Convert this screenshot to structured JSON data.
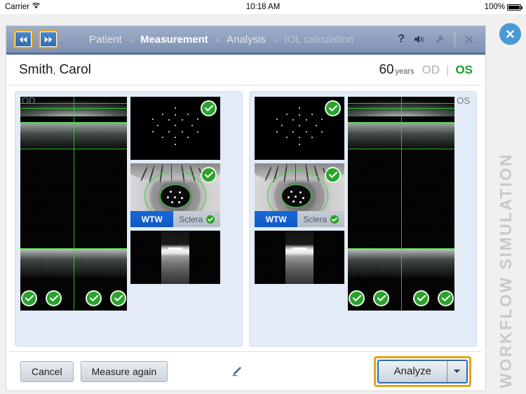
{
  "status_bar": {
    "carrier": "Carrier",
    "wifi_icon": "wifi-icon",
    "time": "10:18 AM",
    "battery_percent": "100%",
    "battery_icon": "battery-full-icon"
  },
  "overlay": {
    "simulation_label": "WORKFLOW SIMULATION",
    "close_icon": "close-circle-icon"
  },
  "navbar": {
    "history_back": {
      "name": "skip-back-icon",
      "label": "Back"
    },
    "history_forward": {
      "name": "skip-forward-icon",
      "label": "Forward"
    },
    "breadcrumbs": [
      {
        "label": "Patient",
        "state": "inactive"
      },
      {
        "label": "Measurement",
        "state": "active"
      },
      {
        "label": "Analysis",
        "state": "inactive"
      },
      {
        "label": "IOL calculation",
        "state": "disabled"
      }
    ],
    "separator": "›",
    "tools": [
      {
        "name": "help-icon",
        "glyph": "?",
        "enabled": true
      },
      {
        "name": "sound-icon",
        "glyph": "speaker",
        "enabled": true
      },
      {
        "name": "wrench-icon",
        "glyph": "wrench",
        "enabled": false
      },
      {
        "name": "close-icon",
        "glyph": "×",
        "enabled": false
      }
    ]
  },
  "patient": {
    "last_name": "Smith",
    "comma": ",",
    "first_name": "Carol",
    "age": "60",
    "age_unit": "years",
    "eye_od": "OD",
    "eye_divider": "|",
    "eye_os": "OS",
    "selected_eye": "OS"
  },
  "measurement": {
    "od": {
      "label": "OD",
      "oct_scan": {
        "name": "oct-bscan-large",
        "checks": 4
      },
      "keratometry": {
        "name": "keratometry-dot-pattern",
        "status": "ok"
      },
      "eye_image": {
        "name": "eye-front-image",
        "status": "ok"
      },
      "toggle": {
        "active": "WTW",
        "inactive": "Sclera",
        "inactive_status": "ok"
      },
      "bscan_thumb": {
        "name": "oct-bscan-thumbnail"
      }
    },
    "os": {
      "label": "OS",
      "oct_scan": {
        "name": "oct-bscan-large",
        "checks": 4
      },
      "keratometry": {
        "name": "keratometry-dot-pattern",
        "status": "ok"
      },
      "eye_image": {
        "name": "eye-front-image",
        "status": "ok"
      },
      "toggle": {
        "active": "WTW",
        "inactive": "Sclera",
        "inactive_status": "ok"
      },
      "bscan_thumb": {
        "name": "oct-bscan-thumbnail"
      }
    }
  },
  "footer": {
    "cancel": "Cancel",
    "measure_again": "Measure again",
    "edit_icon": "pencil-edit-icon",
    "analyze": "Analyze",
    "analyze_caret": "caret-down-icon"
  },
  "colors": {
    "accent_blue": "#1868d8",
    "focus_gold": "#e8a317",
    "status_green": "#29a329",
    "nav_blue": "#8ea0bd",
    "panel_bg": "#e3ecf6",
    "os_green": "#1f9b2f",
    "close_blue": "#4a9ad4"
  }
}
